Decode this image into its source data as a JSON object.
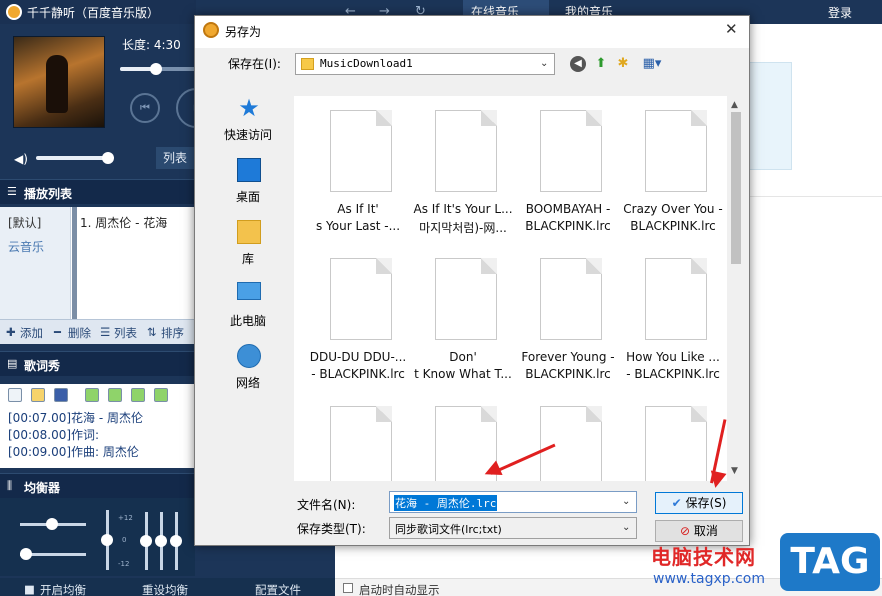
{
  "player": {
    "app_title": "千千静听（百度音乐版）",
    "length_label": "长度: 4:30",
    "progress_fraction": 0.45,
    "volume_fraction": 1.0,
    "list_button": "列表",
    "playlist_title": "播放列表",
    "playlist_groups": [
      "[默认]",
      "云音乐"
    ],
    "playlist_items": [
      "1. 周杰伦 - 花海"
    ],
    "playlist_tools": [
      "添加",
      "删除",
      "列表",
      "排序"
    ],
    "lyrics_title": "歌词秀",
    "lyrics": [
      "[00:07.00]花海 - 周杰伦",
      "[00:08.00]作词:",
      "[00:09.00]作曲: 周杰伦"
    ],
    "eq_title": "均衡器",
    "eq_scale_top": "+12",
    "eq_scale_mid": "0",
    "eq_scale_bottom": "-12",
    "bottom_buttons": [
      "开启均衡",
      "重设均衡",
      "配置文件"
    ]
  },
  "main": {
    "tab_online": "在线音乐",
    "tab_mine": "我的音乐",
    "login": "登录",
    "auto_show": "启动时自动显示"
  },
  "dialog": {
    "title": "另存为",
    "save_in_label": "保存在(I):",
    "save_in_value": "MusicDownload1",
    "places": [
      "快速访问",
      "桌面",
      "库",
      "此电脑",
      "网络"
    ],
    "files": [
      {
        "l1": "As If It'",
        "l2": "s Your Last -..."
      },
      {
        "l1": "As If It's Your L...",
        "l2": "마지막처럼)-网..."
      },
      {
        "l1": "BOOMBAYAH -",
        "l2": "BLACKPINK.lrc"
      },
      {
        "l1": "Crazy Over You -",
        "l2": "BLACKPINK.lrc"
      },
      {
        "l1": "DDU-DU DDU-...",
        "l2": "- BLACKPINK.lrc"
      },
      {
        "l1": "Don'",
        "l2": "t Know What T..."
      },
      {
        "l1": "Forever Young -",
        "l2": "BLACKPINK.lrc"
      },
      {
        "l1": "How You Like ...",
        "l2": "- BLACKPINK.lrc"
      },
      {
        "l1": "",
        "l2": ""
      },
      {
        "l1": "",
        "l2": ""
      },
      {
        "l1": "",
        "l2": ""
      },
      {
        "l1": "",
        "l2": ""
      }
    ],
    "filename_label": "文件名(N):",
    "filename_value": "花海 - 周杰伦.lrc",
    "filetype_label": "保存类型(T):",
    "filetype_value": "同步歌词文件(lrc;txt)",
    "save_button": "保存(S)",
    "cancel_button": "取消"
  },
  "watermark": {
    "site_name": "电脑技术网",
    "url": "www.tagxp.com",
    "tag": "TAG"
  },
  "colors": {
    "player_bg": "#1c3558",
    "dialog_bg": "#f0f0f0",
    "accent": "#0078d7",
    "annotation_arrow": "#e02020"
  }
}
